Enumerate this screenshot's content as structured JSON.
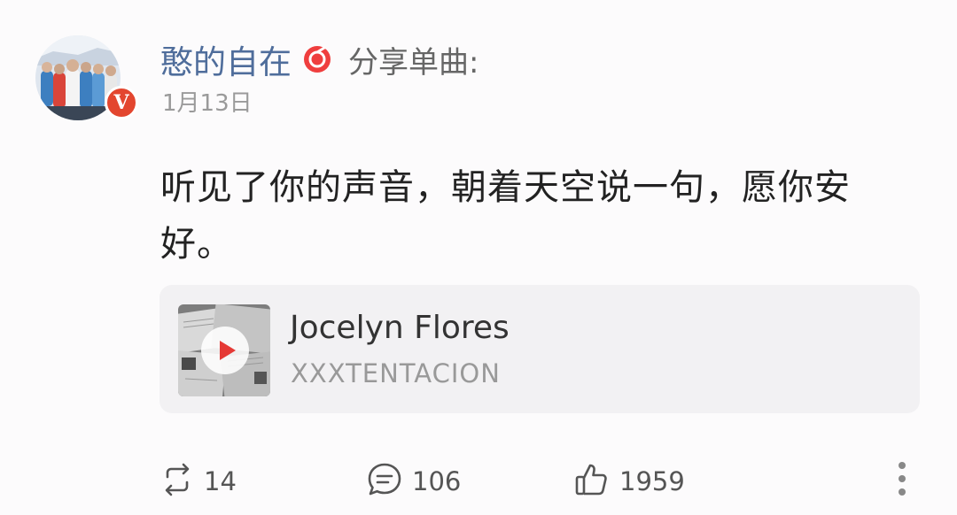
{
  "user": {
    "name": "憨的自在",
    "verified_badge_letter": "V",
    "verified_color": "#e3462f",
    "username_color": "#4f6d9b"
  },
  "post": {
    "action_text": "分享单曲:",
    "date": "1月13日",
    "text": "听见了你的声音，朝着天空说一句，愿你安好。"
  },
  "music_card": {
    "title": "Jocelyn Flores",
    "artist": "XXXTENTACION",
    "play_icon": "play-icon",
    "play_color": "#e53935"
  },
  "actions": {
    "repost": {
      "icon": "repost-icon",
      "count": "14"
    },
    "comment": {
      "icon": "comment-icon",
      "count": "106"
    },
    "like": {
      "icon": "thumbs-up-icon",
      "count": "1959"
    },
    "more": {
      "icon": "more-vertical-icon"
    }
  }
}
